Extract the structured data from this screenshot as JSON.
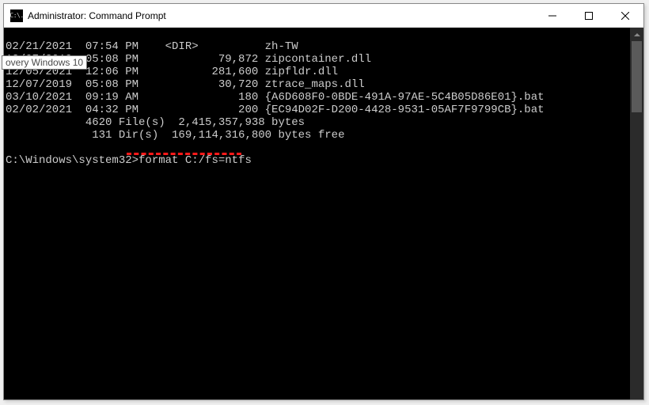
{
  "window": {
    "title": "Administrator: Command Prompt",
    "icon_text": "C:\\."
  },
  "tooltip": {
    "text": "overy Windows 10"
  },
  "terminal": {
    "lines": [
      "02/21/2021  07:54 PM    <DIR>          zh-TW",
      "12/07/2019  05:08 PM            79,872 zipcontainer.dll",
      "12/05/2021  12:06 PM           281,600 zipfldr.dll",
      "12/07/2019  05:08 PM            30,720 ztrace_maps.dll",
      "03/10/2021  09:19 AM               180 {A6D608F0-0BDE-491A-97AE-5C4B05D86E01}.bat",
      "02/02/2021  04:32 PM               200 {EC94D02F-D200-4428-9531-05AF7F9799CB}.bat",
      "            4620 File(s)  2,415,357,938 bytes",
      "             131 Dir(s)  169,114,316,800 bytes free",
      "",
      "C:\\Windows\\system32>format C:/fs=ntfs"
    ],
    "prompt": "C:\\Windows\\system32>",
    "command": "format C:/fs=ntfs"
  },
  "annotation": {
    "underline_target": "format C:/fs=ntfs"
  }
}
